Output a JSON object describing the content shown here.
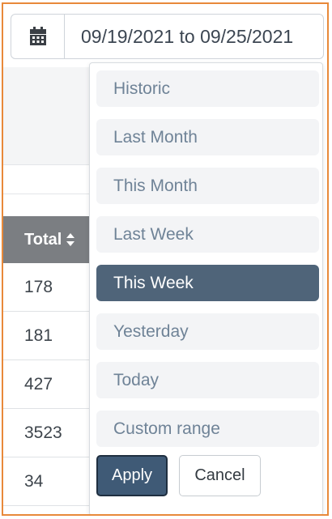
{
  "date_picker": {
    "icon": "calendar-icon",
    "value": "09/19/2021 to 09/25/2021"
  },
  "table": {
    "header": {
      "label": "Total",
      "sort_icon": "sort-icon"
    },
    "rows": [
      "178",
      "181",
      "427",
      "3523",
      "34"
    ]
  },
  "ranges": {
    "items": [
      "Historic",
      "Last Month",
      "This Month",
      "Last Week",
      "This Week",
      "Yesterday",
      "Today",
      "Custom range"
    ],
    "selected": "This Week"
  },
  "buttons": {
    "apply": "Apply",
    "cancel": "Cancel"
  },
  "colors": {
    "frame_border": "#e8893a",
    "active_range": "#4f6479",
    "apply_button": "#3f5a76",
    "table_header": "#7b7e82"
  }
}
